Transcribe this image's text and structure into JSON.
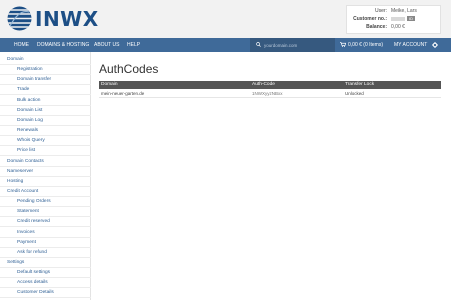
{
  "brand": {
    "logo_text": "INWX"
  },
  "account": {
    "user_label": "User:",
    "user_value": "Meike, Lars",
    "customer_label": "Customer no.:",
    "customer_badge": "ID",
    "balance_label": "Balance:",
    "balance_value": "0,00 €"
  },
  "nav": {
    "items": [
      "HOME",
      "DOMAINS & HOSTING",
      "ABOUT US",
      "HELP"
    ],
    "search_placeholder": "yourdomain.com",
    "cart_label": "0,00 € (0 Items)",
    "my_account": "MY ACCOUNT"
  },
  "sidebar": {
    "items": [
      {
        "label": "Domain",
        "level": "category"
      },
      {
        "label": "Registration",
        "level": "sub"
      },
      {
        "label": "Domain transfer",
        "level": "sub"
      },
      {
        "label": "Trade",
        "level": "sub"
      },
      {
        "label": "Bulk action",
        "level": "sub"
      },
      {
        "label": "Domain List",
        "level": "sub"
      },
      {
        "label": "Domain Log",
        "level": "sub"
      },
      {
        "label": "Renewals",
        "level": "sub"
      },
      {
        "label": "Whois Query",
        "level": "sub"
      },
      {
        "label": "Price list",
        "level": "sub"
      },
      {
        "label": "Domain Contacts",
        "level": "category"
      },
      {
        "label": "Nameserver",
        "level": "category"
      },
      {
        "label": "Hosting",
        "level": "category"
      },
      {
        "label": "Credit Account",
        "level": "category"
      },
      {
        "label": "Pending Orders",
        "level": "sub"
      },
      {
        "label": "Statement",
        "level": "sub"
      },
      {
        "label": "Credit reserved",
        "level": "sub"
      },
      {
        "label": "Invoices",
        "level": "sub"
      },
      {
        "label": "Payment",
        "level": "sub"
      },
      {
        "label": "Ask for refund",
        "level": "sub"
      },
      {
        "label": "Settings",
        "level": "category"
      },
      {
        "label": "Default settings",
        "level": "sub"
      },
      {
        "label": "Access details",
        "level": "sub"
      },
      {
        "label": "Customer Details",
        "level": "sub"
      }
    ]
  },
  "main": {
    "title": "AuthCodes",
    "table": {
      "headers": [
        "Domain",
        "Auth-Code",
        "Transfer Lock"
      ],
      "rows": [
        [
          "mein-neuer-garten.de",
          "1NWXyyzNBxx",
          "Unlocked"
        ]
      ]
    }
  },
  "colors": {
    "navbar": "#3f6a99",
    "brand": "#1d4f86",
    "link": "#2e5f94",
    "table_header": "#555555"
  }
}
